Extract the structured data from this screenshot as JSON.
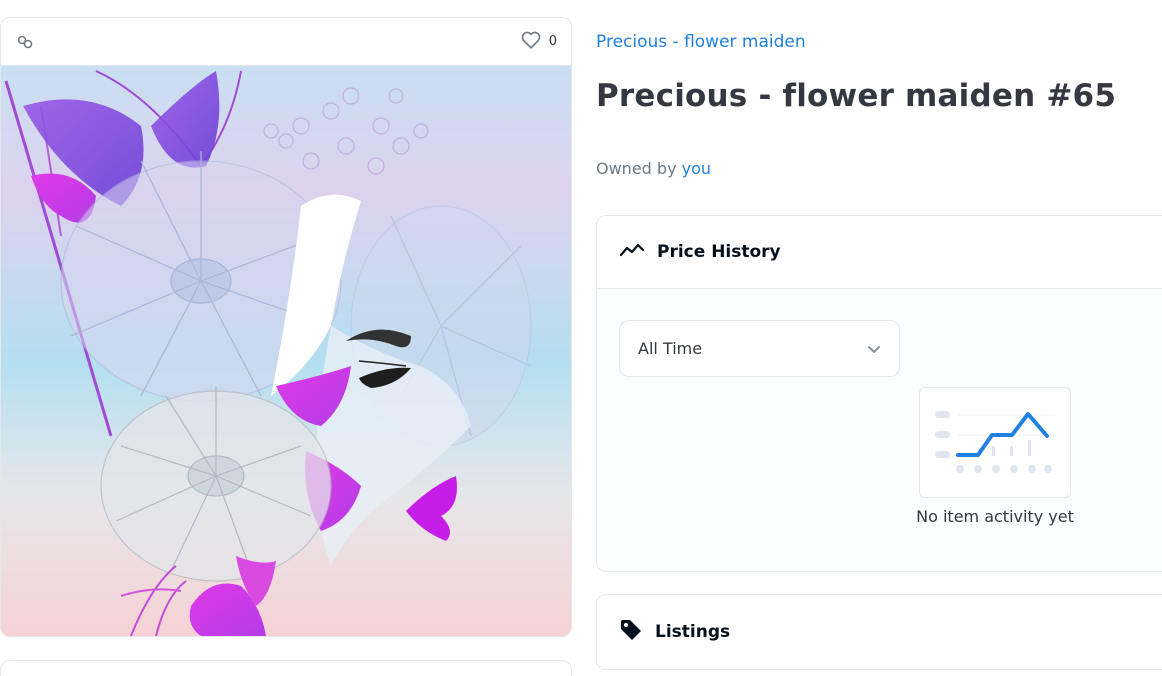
{
  "media": {
    "favorite_count": "0"
  },
  "item": {
    "collection_name": "Precious - flower maiden",
    "title": "Precious - flower maiden #65",
    "owned_by_label": "Owned by",
    "owner": "you"
  },
  "price_history": {
    "title": "Price History",
    "time_filter": {
      "selected": "All Time"
    },
    "empty_message": "No item activity yet"
  },
  "listings": {
    "title": "Listings"
  },
  "icons": {
    "chain": "chain-icon",
    "heart": "heart-icon",
    "trend": "trend-line-icon",
    "chevron": "chevron-down-icon",
    "tag": "tag-icon"
  },
  "colors": {
    "link": "#2081e2",
    "text_primary": "#353840",
    "text_secondary": "#707a83",
    "border": "#e5e8eb",
    "chart_accent": "#2081e2"
  }
}
